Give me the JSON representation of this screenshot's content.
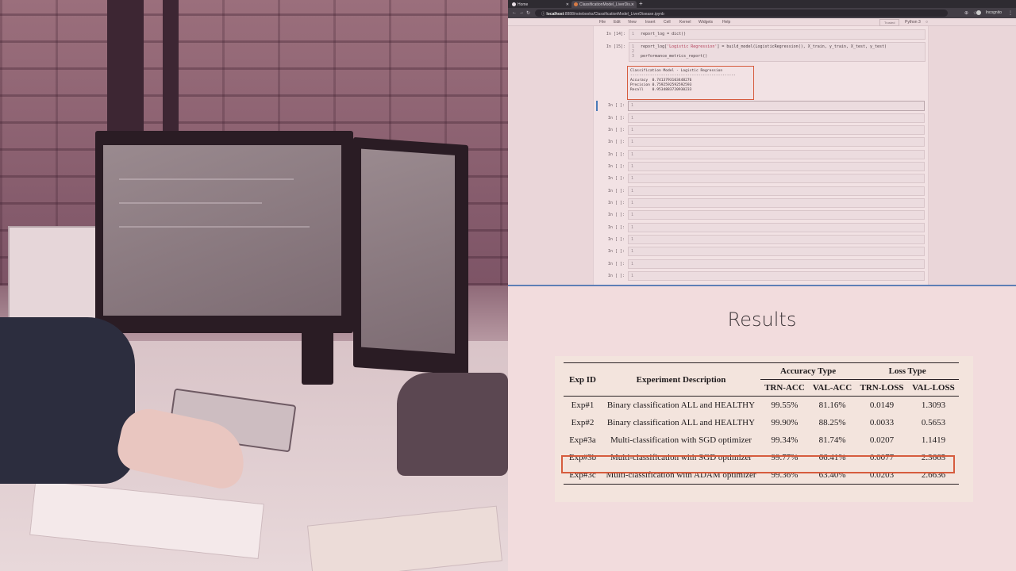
{
  "browser": {
    "tabs": [
      {
        "label": "Home",
        "active": false
      },
      {
        "label": "ClassificationModel_LiverDis...",
        "active": true
      }
    ],
    "url_host": "localhost",
    "url_rest": ":8888/notebooks/ClassificationModel_LiverDisease.ipynb",
    "incognito_label": "Incognito",
    "nav_icons": [
      "back-icon",
      "forward-icon",
      "reload-icon"
    ]
  },
  "notebook": {
    "menu": [
      "File",
      "Edit",
      "View",
      "Insert",
      "Cell",
      "Kernel",
      "Widgets",
      "Help"
    ],
    "trusted": "Trusted",
    "kernel": "Python 3",
    "cells": [
      {
        "prompt": "In [14]:",
        "lines": [
          "report_log = dict()"
        ]
      },
      {
        "prompt": "In [15]:",
        "lines": [
          "report_log['Logistic Regression'] = build_model(LogisticRegression(), X_train, y_train, X_test, y_test)",
          "",
          "performance_metrics_report()"
        ]
      }
    ],
    "output_lines": [
      "Classification Model - Logistic Regression",
      "------------------------------------------------",
      "",
      "Accuracy  0.7413793103448276",
      "Precision 0.7592592592592593",
      "Recall    0.9534883720930233"
    ],
    "empty_prompt": "In [ ]:",
    "line_one": "1",
    "line_two": "2",
    "line_three": "3"
  },
  "slide": {
    "title": "Results",
    "table": {
      "header_exp_id": "Exp ID",
      "header_desc": "Experiment Description",
      "group_accuracy": "Accuracy Type",
      "group_loss": "Loss Type",
      "sub_headers": [
        "TRN-ACC",
        "VAL-ACC",
        "TRN-LOSS",
        "VAL-LOSS"
      ],
      "rows": [
        {
          "id": "Exp#1",
          "desc": "Binary classification ALL and HEALTHY",
          "trn_acc": "99.55%",
          "val_acc": "81.16%",
          "trn_loss": "0.0149",
          "val_loss": "1.3093"
        },
        {
          "id": "Exp#2",
          "desc": "Binary classification ALL and HEALTHY",
          "trn_acc": "99.90%",
          "val_acc": "88.25%",
          "trn_loss": "0.0033",
          "val_loss": "0.5653"
        },
        {
          "id": "Exp#3a",
          "desc": "Multi-classification with SGD optimizer",
          "trn_acc": "99.34%",
          "val_acc": "81.74%",
          "trn_loss": "0.0207",
          "val_loss": "1.1419"
        },
        {
          "id": "Exp#3b",
          "desc": "Multi-classification with SGD optimizer",
          "trn_acc": "99.77%",
          "val_acc": "66.41%",
          "trn_loss": "0.0077",
          "val_loss": "2.3665"
        },
        {
          "id": "Exp#3c",
          "desc": "Multi-classification with ADAM optimizer",
          "trn_acc": "99.36%",
          "val_acc": "63.40%",
          "trn_loss": "0.0203",
          "val_loss": "2.6636"
        }
      ]
    }
  },
  "colors": {
    "highlight": "#d65c3e",
    "divider": "#5e7fb6",
    "slide_bg": "#f2dcdd"
  }
}
